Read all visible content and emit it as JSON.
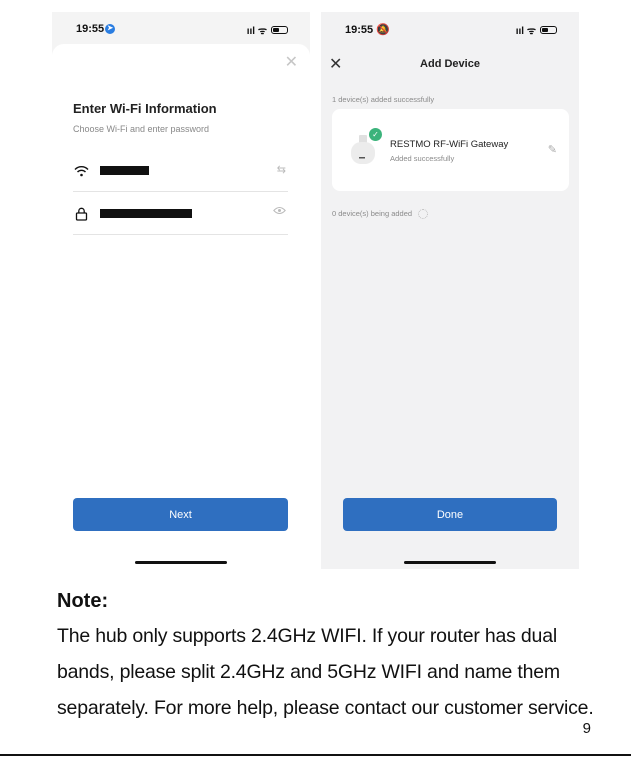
{
  "phone1": {
    "status_time": "19:55",
    "status_icons": "ııl ᯤ",
    "title": "Enter Wi-Fi Information",
    "subtitle": "Choose Wi-Fi and enter password",
    "next_button": "Next"
  },
  "phone2": {
    "status_time": "19:55",
    "status_icons": "ııl ᯤ",
    "header_title": "Add Device",
    "added_label": "1 device(s) added successfully",
    "device_name": "RESTMO RF-WiFi Gateway",
    "device_status": "Added successfully",
    "adding_label": "0 device(s) being added",
    "done_button": "Done"
  },
  "note": {
    "title": "Note:",
    "lines": [
      "The hub only supports 2.4GHz WIFI. If your router has dual",
      "bands, please split 2.4GHz and 5GHz WIFI and name them",
      "separately. For more help, please contact our customer service."
    ]
  },
  "page_number": "9",
  "colors": {
    "button_blue": "#2f6fc0",
    "success_green": "#3bb37b"
  }
}
